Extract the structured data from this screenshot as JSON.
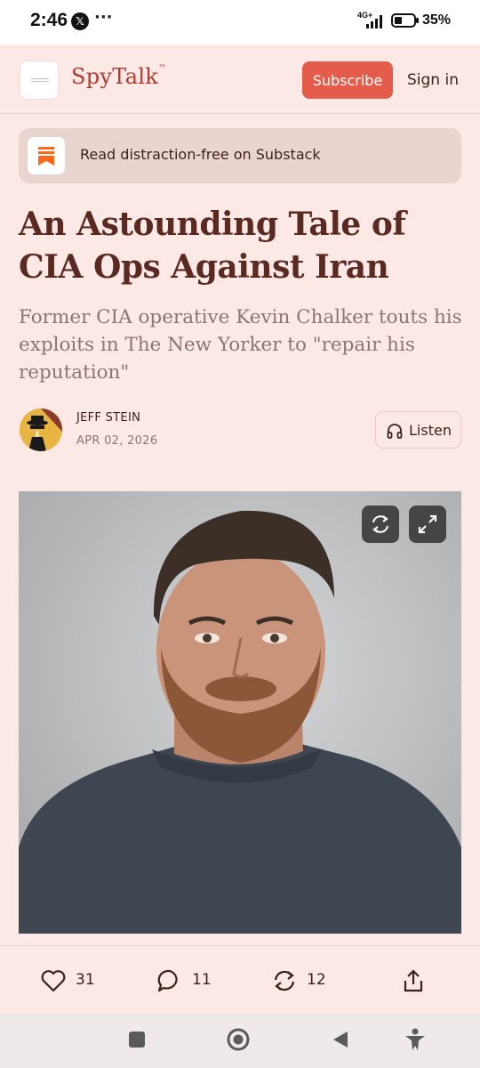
{
  "status_bar": {
    "time": "2:46",
    "notification_icons": [
      "x-icon",
      "more-dots"
    ],
    "network": "4G+",
    "battery": "35%"
  },
  "header": {
    "brand_prefix": "Spy",
    "brand_suffix": "Talk",
    "subscribe_label": "Subscribe",
    "sign_in_label": "Sign in"
  },
  "banner": {
    "text": "Read distraction-free on Substack",
    "icon": "substack-icon"
  },
  "article": {
    "title": "An Astounding Tale of CIA Ops Against Iran",
    "subtitle": "Former CIA operative Kevin Chalker touts his exploits in The New Yorker to \"repair his reputation\"",
    "author": "JEFF STEIN",
    "date": "APR 02, 2026",
    "listen_label": "Listen"
  },
  "photo": {
    "controls": [
      "refresh-icon",
      "expand-icon"
    ]
  },
  "actions": {
    "likes": "31",
    "comments": "11",
    "restacks": "12",
    "share_icon": "share-icon"
  },
  "colors": {
    "background": "#fce9e6",
    "accent": "#e35d4a",
    "brand": "#b03a2e",
    "title": "#5a2a22"
  }
}
